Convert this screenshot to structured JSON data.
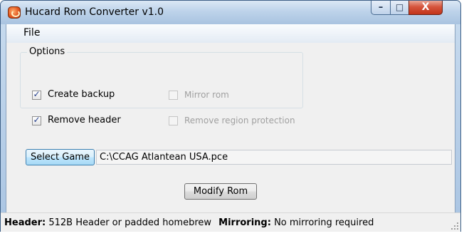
{
  "window": {
    "title": "Hucard Rom Converter v1.0",
    "icon": "app-logo-icon",
    "controls": {
      "minimize": "–",
      "maximize": "□",
      "close": "X"
    }
  },
  "menu": {
    "file": "File"
  },
  "options": {
    "group_label": "Options",
    "create_backup": {
      "label": "Create backup",
      "checked": true,
      "enabled": true
    },
    "remove_header": {
      "label": "Remove header",
      "checked": true,
      "enabled": true
    },
    "mirror_rom": {
      "label": "Mirror rom",
      "checked": false,
      "enabled": false
    },
    "remove_region": {
      "label": "Remove region protection",
      "checked": false,
      "enabled": false
    }
  },
  "game": {
    "select_label": "Select Game",
    "path": "C:\\CCAG Atlantean USA.pce"
  },
  "modify": {
    "label": "Modify Rom"
  },
  "status": {
    "header_key": "Header:",
    "header_value": "512B Header or padded homebrew",
    "mirroring_key": "Mirroring:",
    "mirroring_value": "No mirroring required"
  },
  "colors": {
    "titlebar": "#bdd3ea",
    "close_button": "#c2341a",
    "client_bg": "#f0f0f0",
    "default_button": "#bee6fd"
  }
}
